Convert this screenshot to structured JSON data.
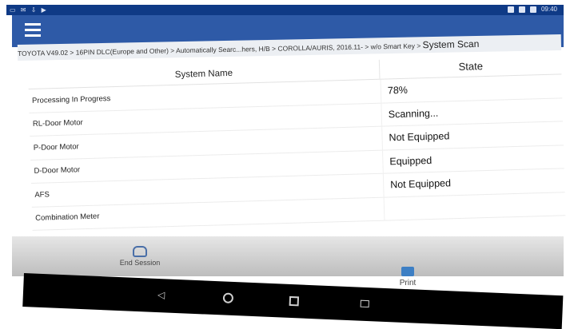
{
  "status_bar": {
    "left_icons": "▭ ✉ ⇩ ▶",
    "time": "09:40"
  },
  "breadcrumb": {
    "path": "TOYOTA V49.02 > 16PIN DLC(Europe and Other) > Automatically Searc...hers, H/B > COROLLA/AURIS, 2016.11- > w/o Smart Key > ",
    "current": "System Scan"
  },
  "table": {
    "headers": {
      "name": "System Name",
      "state": "State"
    },
    "rows": [
      {
        "name": "Processing In Progress",
        "state": "78%"
      },
      {
        "name": "RL-Door Motor",
        "state": "Scanning..."
      },
      {
        "name": "P-Door Motor",
        "state": "Not Equipped"
      },
      {
        "name": "D-Door Motor",
        "state": "Equipped"
      },
      {
        "name": "AFS",
        "state": "Not Equipped"
      },
      {
        "name": "Combination Meter",
        "state": ""
      }
    ]
  },
  "footer": {
    "end_session": "End Session",
    "print": "Print"
  },
  "icons": {
    "menu": "menu-icon",
    "end_session": "car-icon",
    "print": "printer-icon"
  },
  "colors": {
    "appbar": "#2e5aa7",
    "status_bar": "#0f3a86"
  }
}
